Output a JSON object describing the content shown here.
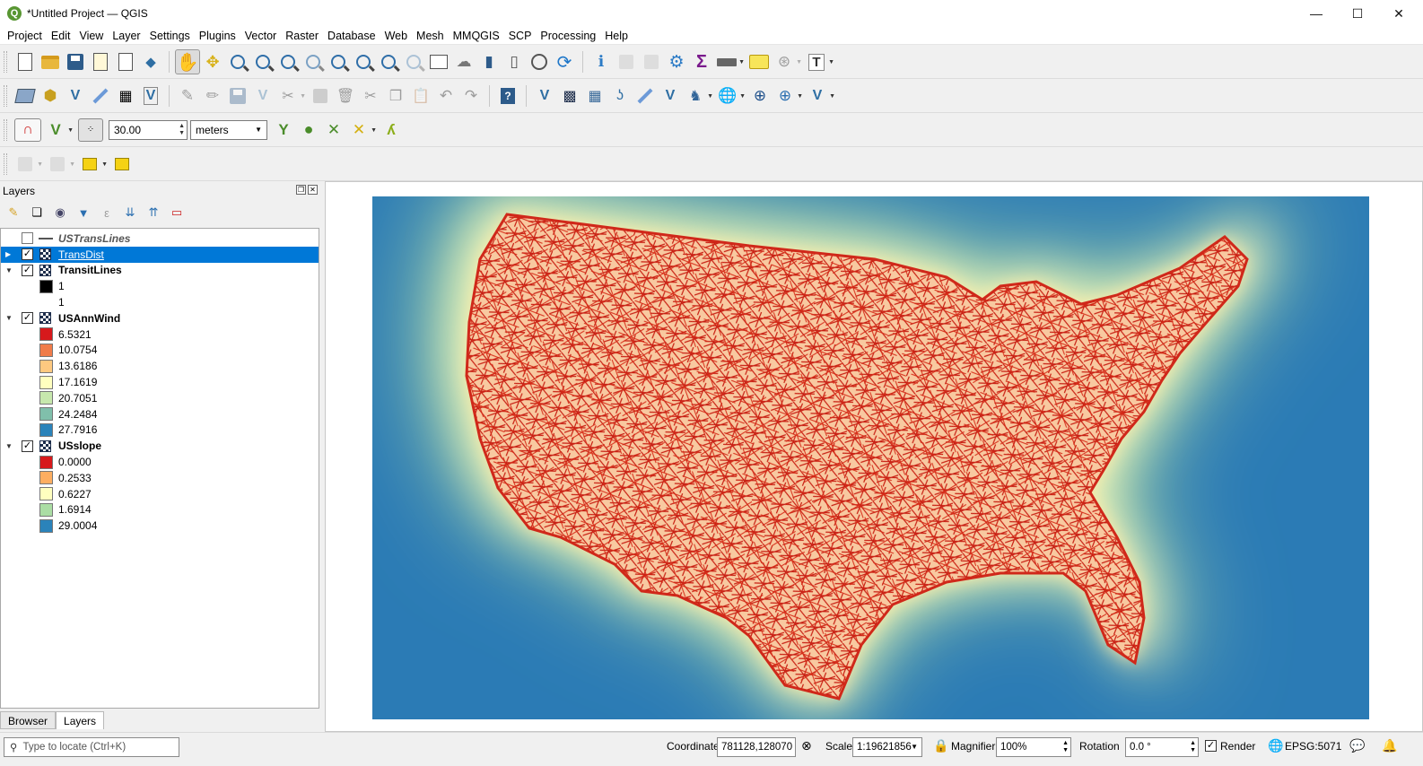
{
  "window": {
    "title": "*Untitled Project — QGIS",
    "logo_letter": "Q",
    "minimize": "—",
    "maximize": "☐",
    "close": "✕"
  },
  "menu": [
    "Project",
    "Edit",
    "View",
    "Layer",
    "Settings",
    "Plugins",
    "Vector",
    "Raster",
    "Database",
    "Web",
    "Mesh",
    "MMQGIS",
    "SCP",
    "Processing",
    "Help"
  ],
  "snapping": {
    "tolerance": "30.00",
    "units": "meters"
  },
  "layers_panel": {
    "title": "Layers",
    "layers": [
      {
        "name": "USTransLines",
        "checked": false,
        "icon": "line-icon"
      },
      {
        "name": "TransDist",
        "checked": true,
        "icon": "raster-icon",
        "selected": true
      },
      {
        "name": "TransitLines",
        "checked": true,
        "icon": "raster-icon",
        "legend": [
          {
            "label": "1",
            "color": "#000000"
          },
          {
            "label": "1",
            "color": "#ffffff"
          }
        ]
      },
      {
        "name": "USAnnWind",
        "checked": true,
        "icon": "raster-icon",
        "legend": [
          {
            "label": "6.5321",
            "color": "#d7191c"
          },
          {
            "label": "10.0754",
            "color": "#f07c4a"
          },
          {
            "label": "13.6186",
            "color": "#fec980"
          },
          {
            "label": "17.1619",
            "color": "#ffffbf"
          },
          {
            "label": "20.7051",
            "color": "#c7e8ad"
          },
          {
            "label": "24.2484",
            "color": "#80bfab"
          },
          {
            "label": "27.7916",
            "color": "#2b83ba"
          }
        ]
      },
      {
        "name": "USslope",
        "checked": true,
        "icon": "raster-icon",
        "legend": [
          {
            "label": "0.0000",
            "color": "#d7191c"
          },
          {
            "label": "0.2533",
            "color": "#fdae61"
          },
          {
            "label": "0.6227",
            "color": "#ffffbf"
          },
          {
            "label": "1.6914",
            "color": "#abdda4"
          },
          {
            "label": "29.0004",
            "color": "#2b83ba"
          }
        ]
      }
    ],
    "tabs": [
      "Browser",
      "Layers"
    ]
  },
  "statusbar": {
    "locator_placeholder": "Type to locate (Ctrl+K)",
    "coordinate_label": "Coordinate",
    "coordinate_value": "781128,128070",
    "scale_label": "Scale",
    "scale_value": "1:19621856",
    "magnifier_label": "Magnifier",
    "magnifier_value": "100%",
    "rotation_label": "Rotation",
    "rotation_value": "0.0 °",
    "render_label": "Render",
    "crs_label": "EPSG:5071"
  },
  "colors": {
    "selection": "#0078d7",
    "map_near": "#e8301f",
    "map_far": "#2b7bb5"
  }
}
